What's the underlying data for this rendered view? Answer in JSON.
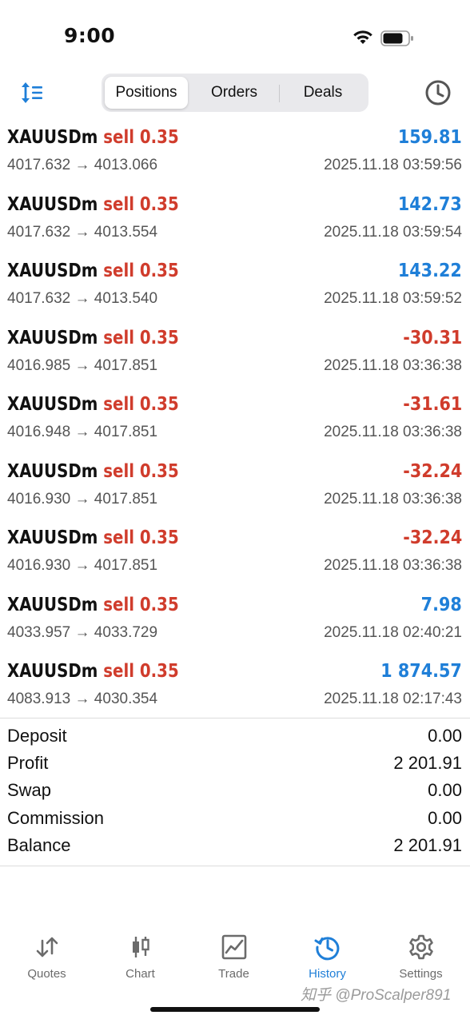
{
  "status_bar": {
    "time": "9:00"
  },
  "toolbar": {
    "segments": [
      "Positions",
      "Orders",
      "Deals"
    ],
    "active_segment": "Positions"
  },
  "deals": [
    {
      "symbol": "XAUUSDm",
      "side": "sell",
      "volume": "0.35",
      "prices": "4017.632 → 4013.066",
      "time": "2025.11.18 03:59:56",
      "profit": "159.81",
      "sign": "pos"
    },
    {
      "symbol": "XAUUSDm",
      "side": "sell",
      "volume": "0.35",
      "prices": "4017.632 → 4013.554",
      "time": "2025.11.18 03:59:54",
      "profit": "142.73",
      "sign": "pos"
    },
    {
      "symbol": "XAUUSDm",
      "side": "sell",
      "volume": "0.35",
      "prices": "4017.632 → 4013.540",
      "time": "2025.11.18 03:59:52",
      "profit": "143.22",
      "sign": "pos"
    },
    {
      "symbol": "XAUUSDm",
      "side": "sell",
      "volume": "0.35",
      "prices": "4016.985 → 4017.851",
      "time": "2025.11.18 03:36:38",
      "profit": "-30.31",
      "sign": "neg"
    },
    {
      "symbol": "XAUUSDm",
      "side": "sell",
      "volume": "0.35",
      "prices": "4016.948 → 4017.851",
      "time": "2025.11.18 03:36:38",
      "profit": "-31.61",
      "sign": "neg"
    },
    {
      "symbol": "XAUUSDm",
      "side": "sell",
      "volume": "0.35",
      "prices": "4016.930 → 4017.851",
      "time": "2025.11.18 03:36:38",
      "profit": "-32.24",
      "sign": "neg"
    },
    {
      "symbol": "XAUUSDm",
      "side": "sell",
      "volume": "0.35",
      "prices": "4016.930 → 4017.851",
      "time": "2025.11.18 03:36:38",
      "profit": "-32.24",
      "sign": "neg"
    },
    {
      "symbol": "XAUUSDm",
      "side": "sell",
      "volume": "0.35",
      "prices": "4033.957 → 4033.729",
      "time": "2025.11.18 02:40:21",
      "profit": "7.98",
      "sign": "pos"
    },
    {
      "symbol": "XAUUSDm",
      "side": "sell",
      "volume": "0.35",
      "prices": "4083.913 → 4030.354",
      "time": "2025.11.18 02:17:43",
      "profit": "1 874.57",
      "sign": "pos"
    }
  ],
  "summary": [
    {
      "label": "Deposit",
      "value": "0.00"
    },
    {
      "label": "Profit",
      "value": "2 201.91"
    },
    {
      "label": "Swap",
      "value": "0.00"
    },
    {
      "label": "Commission",
      "value": "0.00"
    },
    {
      "label": "Balance",
      "value": "2 201.91"
    }
  ],
  "tabbar": {
    "items": [
      {
        "label": "Quotes",
        "icon": "quotes-arrows-icon"
      },
      {
        "label": "Chart",
        "icon": "candlestick-icon"
      },
      {
        "label": "Trade",
        "icon": "trade-chart-icon"
      },
      {
        "label": "History",
        "icon": "history-clock-icon"
      },
      {
        "label": "Settings",
        "icon": "gear-icon"
      }
    ],
    "active": "History"
  },
  "watermark": "知乎 @ProScalper891",
  "colors": {
    "accent": "#1f7fd8",
    "negative": "#d03c2c",
    "text": "#111111",
    "muted": "#555555"
  }
}
